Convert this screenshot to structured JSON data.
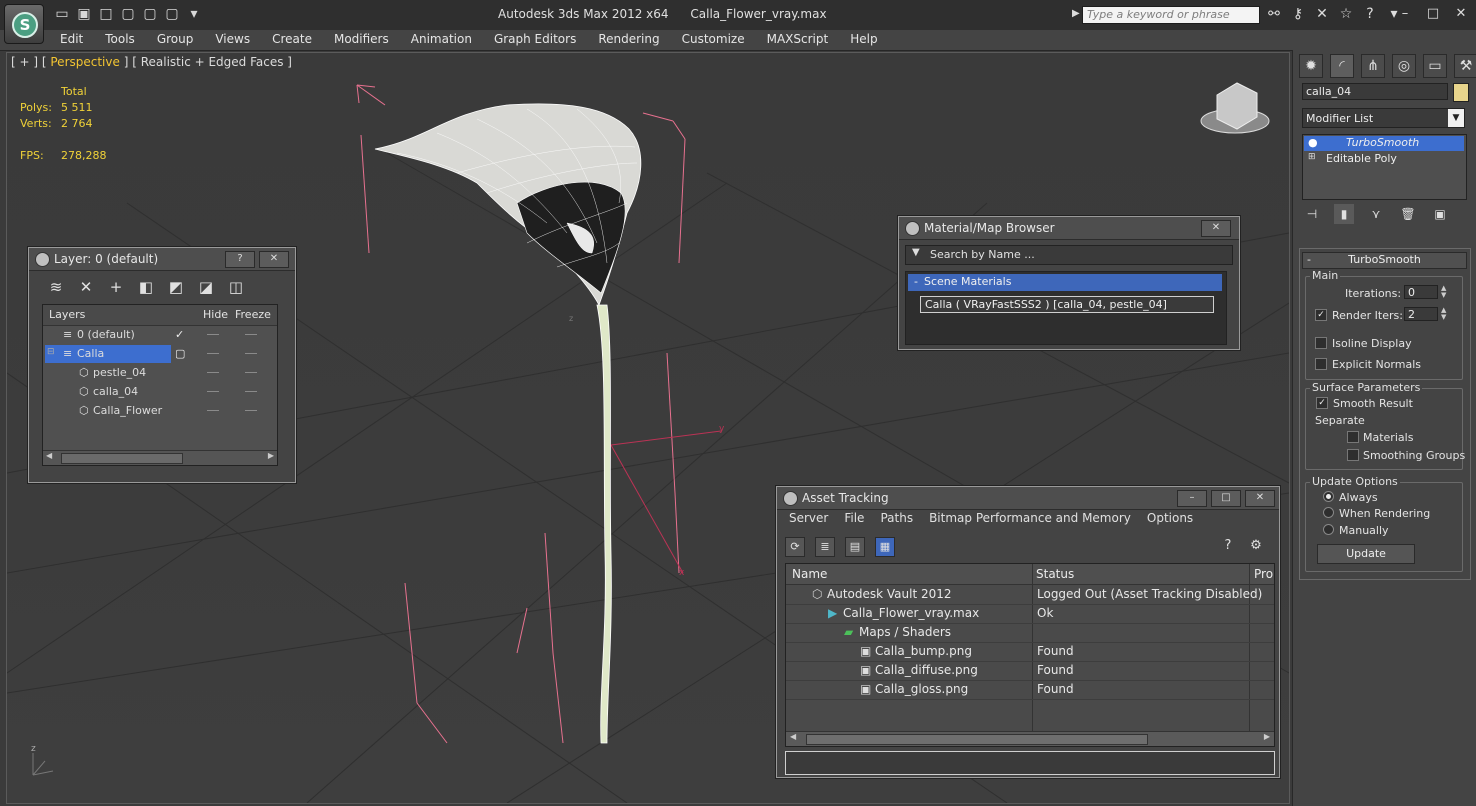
{
  "titlebar": {
    "app_title": "Autodesk 3ds Max  2012 x64",
    "file_name": "Calla_Flower_vray.max",
    "search_placeholder": "Type a keyword or phrase"
  },
  "menu": [
    "Edit",
    "Tools",
    "Group",
    "Views",
    "Create",
    "Modifiers",
    "Animation",
    "Graph Editors",
    "Rendering",
    "Customize",
    "MAXScript",
    "Help"
  ],
  "viewport": {
    "label_prefix": "[ + ] [",
    "label_view": "Perspective",
    "label_suffix": "] [ Realistic + Edged Faces ]",
    "stats": {
      "total_label": "Total",
      "polys_label": "Polys:",
      "polys_value": "5 511",
      "verts_label": "Verts:",
      "verts_value": "2 764",
      "fps_label": "FPS:",
      "fps_value": "278,288"
    },
    "axis_x": "x",
    "axis_y": "y",
    "axis_z": "z"
  },
  "layers_panel": {
    "title": "Layer: 0 (default)",
    "help_btn": "?",
    "close_btn": "✕",
    "columns": {
      "layers": "Layers",
      "hide": "Hide",
      "freeze": "Freeze"
    },
    "rows": [
      {
        "name": "0 (default)"
      },
      {
        "name": "Calla"
      },
      {
        "name": "pestle_04"
      },
      {
        "name": "calla_04"
      },
      {
        "name": "Calla_Flower"
      }
    ]
  },
  "material_browser": {
    "title": "Material/Map Browser",
    "search_placeholder": "Search by Name ...",
    "group_label": "Scene Materials",
    "group_toggle": "-",
    "item": "Calla  ( VRayFastSSS2 )  [calla_04, pestle_04]"
  },
  "asset_tracking": {
    "title": "Asset Tracking",
    "menu": [
      "Server",
      "File",
      "Paths",
      "Bitmap Performance and Memory",
      "Options"
    ],
    "columns": {
      "name": "Name",
      "status": "Status",
      "pro": "Pro"
    },
    "rows": [
      {
        "name": "Autodesk Vault 2012",
        "status": "Logged Out (Asset Tracking Disabled)"
      },
      {
        "name": "Calla_Flower_vray.max",
        "status": "Ok"
      },
      {
        "name": "Maps / Shaders",
        "status": ""
      },
      {
        "name": "Calla_bump.png",
        "status": "Found"
      },
      {
        "name": "Calla_diffuse.png",
        "status": "Found"
      },
      {
        "name": "Calla_gloss.png",
        "status": "Found"
      }
    ]
  },
  "command_panel": {
    "object_name": "calla_04",
    "object_color": "#e8d58c",
    "modifier_list_label": "Modifier List",
    "stack": [
      "TurboSmooth",
      "Editable Poly"
    ],
    "rollout_title": "TurboSmooth",
    "rollout_toggle": "-",
    "main_group": "Main",
    "iterations_label": "Iterations:",
    "iterations_value": "0",
    "render_iters_label": "Render Iters:",
    "render_iters_value": "2",
    "isoline_label": "Isoline Display",
    "explicit_normals_label": "Explicit Normals",
    "surface_group": "Surface Parameters",
    "smooth_result_label": "Smooth Result",
    "separate_label": "Separate",
    "materials_label": "Materials",
    "smoothing_groups_label": "Smoothing Groups",
    "update_group": "Update Options",
    "always_label": "Always",
    "when_rendering_label": "When Rendering",
    "manually_label": "Manually",
    "update_button": "Update"
  },
  "colors": {
    "selection": "#3d6ecf",
    "stats_text": "#f0d238",
    "bounding_box": "#e7718f"
  }
}
